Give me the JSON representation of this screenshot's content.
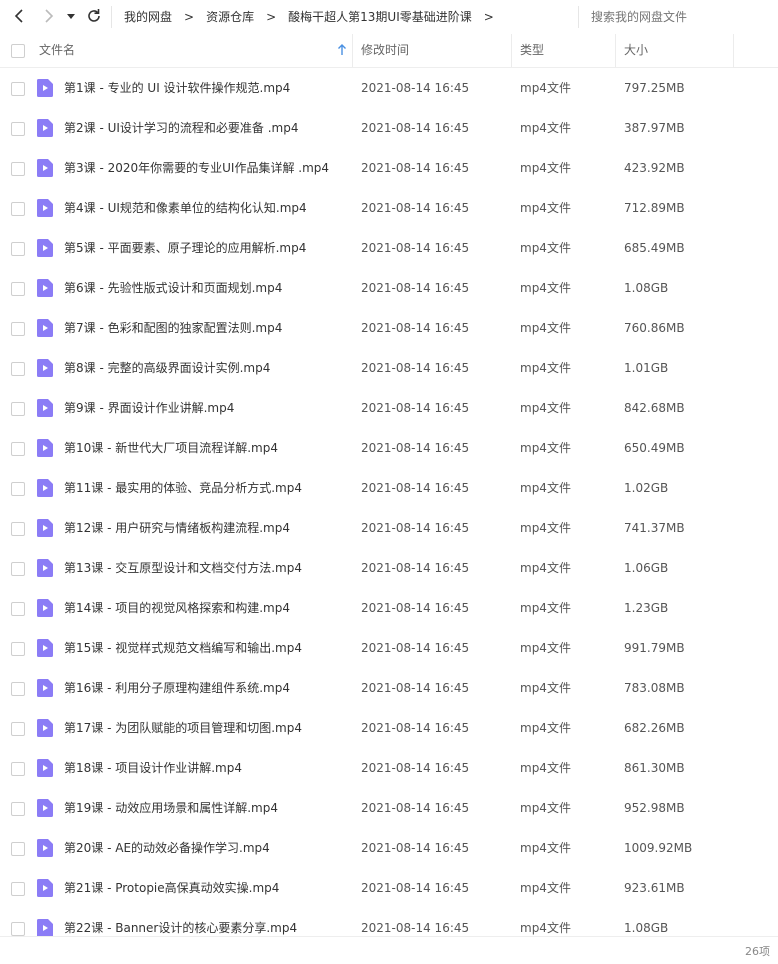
{
  "toolbar": {
    "back_icon": "chevron-left-icon",
    "forward_icon": "chevron-right-icon",
    "dropdown_icon": "caret-down-icon",
    "refresh_icon": "refresh-icon"
  },
  "breadcrumb": {
    "items": [
      "我的网盘",
      "资源仓库",
      "酸梅干超人第13期UI零基础进阶课"
    ],
    "separator": ">"
  },
  "search": {
    "placeholder": "搜索我的网盘文件"
  },
  "columns": {
    "name": "文件名",
    "modified": "修改时间",
    "type": "类型",
    "size": "大小"
  },
  "colors": {
    "accent": "#8b7cf6",
    "text": "#333333",
    "muted": "#999999"
  },
  "files": [
    {
      "name": "第1课 - 专业的 UI 设计软件操作规范.mp4",
      "modified": "2021-08-14 16:45",
      "type": "mp4文件",
      "size": "797.25MB"
    },
    {
      "name": "第2课 - UI设计学习的流程和必要准备 .mp4",
      "modified": "2021-08-14 16:45",
      "type": "mp4文件",
      "size": "387.97MB"
    },
    {
      "name": "第3课 - 2020年你需要的专业UI作品集详解 .mp4",
      "modified": "2021-08-14 16:45",
      "type": "mp4文件",
      "size": "423.92MB"
    },
    {
      "name": "第4课 - UI规范和像素单位的结构化认知.mp4",
      "modified": "2021-08-14 16:45",
      "type": "mp4文件",
      "size": "712.89MB"
    },
    {
      "name": "第5课 - 平面要素、原子理论的应用解析.mp4",
      "modified": "2021-08-14 16:45",
      "type": "mp4文件",
      "size": "685.49MB"
    },
    {
      "name": "第6课 - 先验性版式设计和页面规划.mp4",
      "modified": "2021-08-14 16:45",
      "type": "mp4文件",
      "size": "1.08GB"
    },
    {
      "name": "第7课 - 色彩和配图的独家配置法则.mp4",
      "modified": "2021-08-14 16:45",
      "type": "mp4文件",
      "size": "760.86MB"
    },
    {
      "name": "第8课 - 完整的高级界面设计实例.mp4",
      "modified": "2021-08-14 16:45",
      "type": "mp4文件",
      "size": "1.01GB"
    },
    {
      "name": "第9课 - 界面设计作业讲解.mp4",
      "modified": "2021-08-14 16:45",
      "type": "mp4文件",
      "size": "842.68MB"
    },
    {
      "name": "第10课 - 新世代大厂项目流程详解.mp4",
      "modified": "2021-08-14 16:45",
      "type": "mp4文件",
      "size": "650.49MB"
    },
    {
      "name": "第11课 - 最实用的体验、竞品分析方式.mp4",
      "modified": "2021-08-14 16:45",
      "type": "mp4文件",
      "size": "1.02GB"
    },
    {
      "name": "第12课 - 用户研究与情绪板构建流程.mp4",
      "modified": "2021-08-14 16:45",
      "type": "mp4文件",
      "size": "741.37MB"
    },
    {
      "name": "第13课 - 交互原型设计和文档交付方法.mp4",
      "modified": "2021-08-14 16:45",
      "type": "mp4文件",
      "size": "1.06GB"
    },
    {
      "name": "第14课 - 项目的视觉风格探索和构建.mp4",
      "modified": "2021-08-14 16:45",
      "type": "mp4文件",
      "size": "1.23GB"
    },
    {
      "name": "第15课 - 视觉样式规范文档编写和输出.mp4",
      "modified": "2021-08-14 16:45",
      "type": "mp4文件",
      "size": "991.79MB"
    },
    {
      "name": "第16课 - 利用分子原理构建组件系统.mp4",
      "modified": "2021-08-14 16:45",
      "type": "mp4文件",
      "size": "783.08MB"
    },
    {
      "name": "第17课 - 为团队赋能的项目管理和切图.mp4",
      "modified": "2021-08-14 16:45",
      "type": "mp4文件",
      "size": "682.26MB"
    },
    {
      "name": "第18课 - 项目设计作业讲解.mp4",
      "modified": "2021-08-14 16:45",
      "type": "mp4文件",
      "size": "861.30MB"
    },
    {
      "name": "第19课 - 动效应用场景和属性详解.mp4",
      "modified": "2021-08-14 16:45",
      "type": "mp4文件",
      "size": "952.98MB"
    },
    {
      "name": "第20课 - AE的动效必备操作学习.mp4",
      "modified": "2021-08-14 16:45",
      "type": "mp4文件",
      "size": "1009.92MB"
    },
    {
      "name": "第21课 - Protopie高保真动效实操.mp4",
      "modified": "2021-08-14 16:45",
      "type": "mp4文件",
      "size": "923.61MB"
    },
    {
      "name": "第22课 - Banner设计的核心要素分享.mp4",
      "modified": "2021-08-14 16:45",
      "type": "mp4文件",
      "size": "1.08GB"
    }
  ],
  "footer": {
    "count": "26项"
  }
}
